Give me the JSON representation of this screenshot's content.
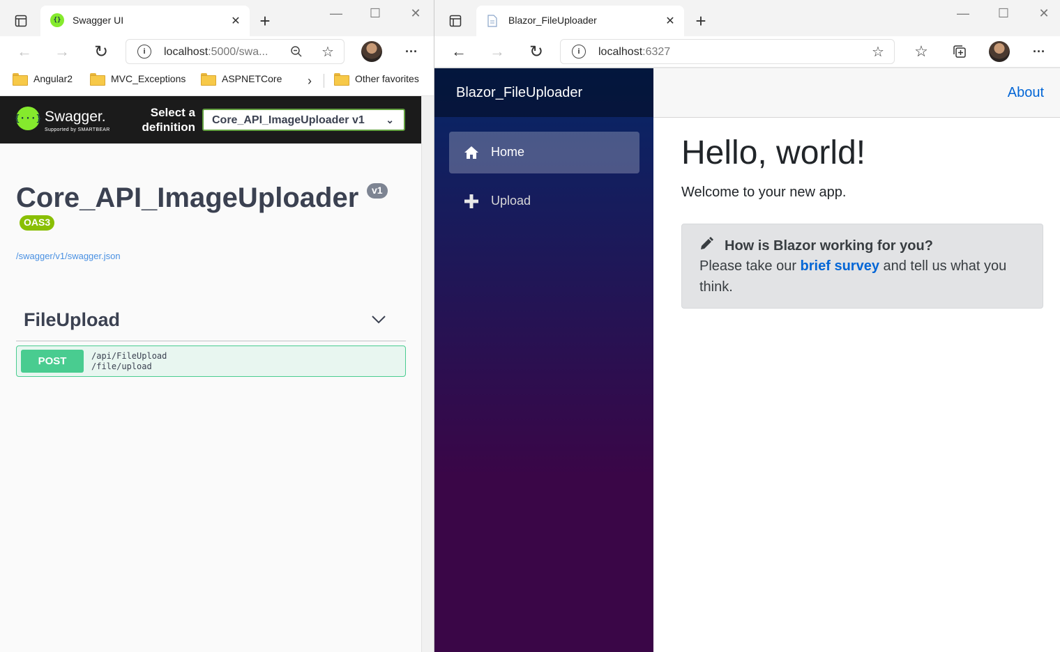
{
  "left_browser": {
    "tab_title": "Swagger UI",
    "address_host": "localhost",
    "address_rest": ":5000/swa...",
    "favorites": [
      "Angular2",
      "MVC_Exceptions",
      "ASPNETCore",
      "Other favorites"
    ],
    "swagger": {
      "logo_text": "Swagger.",
      "logo_sub": "Supported by SMARTBEAR",
      "select_label_line1": "Select a",
      "select_label_line2": "definition",
      "selected_definition": "Core_API_ImageUploader v1",
      "title": "Core_API_ImageUploader",
      "version_badge": "v1",
      "oas_badge": "OAS3",
      "spec_link": "/swagger/v1/swagger.json",
      "section_title": "FileUpload",
      "operation": {
        "method": "POST",
        "path": "/api/FileUpload",
        "path2": "/file/upload"
      }
    }
  },
  "right_browser": {
    "tab_title": "Blazor_FileUploader",
    "address_host": "localhost",
    "address_rest": ":6327",
    "app": {
      "brand": "Blazor_FileUploader",
      "nav": [
        {
          "label": "Home",
          "icon": "home-icon",
          "active": true
        },
        {
          "label": "Upload",
          "icon": "plus-icon",
          "active": false
        }
      ],
      "top_link": "About",
      "heading": "Hello, world!",
      "welcome": "Welcome to your new app.",
      "survey": {
        "title": "How is Blazor working for you?",
        "text_before": "Please take our",
        "link": "brief survey",
        "text_after": "and tell us what you think."
      }
    }
  }
}
